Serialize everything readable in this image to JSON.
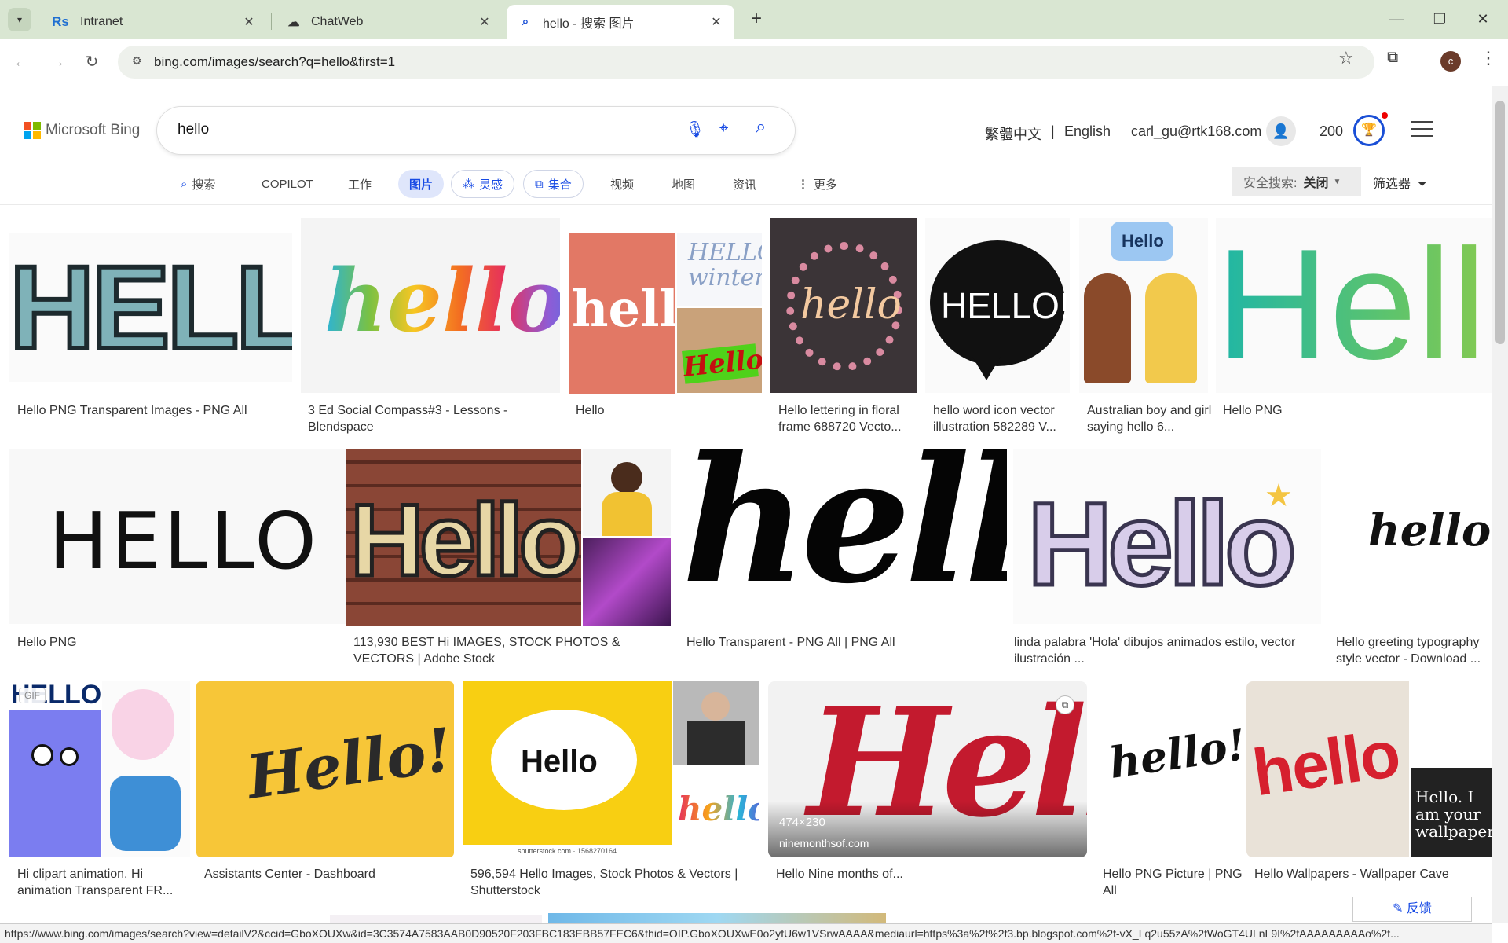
{
  "browser": {
    "tabs": [
      {
        "label": "Intranet",
        "favicon": "Rs"
      },
      {
        "label": "ChatWeb",
        "favicon": "cloud-icon"
      },
      {
        "label": "hello - 搜索 图片",
        "favicon": "search-icon"
      }
    ],
    "url": "bing.com/images/search?q=hello&first=1",
    "profile_initial": "c",
    "status_url": "https://www.bing.com/images/search?view=detailV2&ccid=GboXOUXw&id=3C3574A7583AAB0D90520F203FBC183EBB57FEC6&thid=OIP.GboXOUXwE0o2yfU6w1VSrwAAAA&mediaurl=https%3a%2f%2f3.bp.blogspot.com%2f-vX_Lq2u55zA%2fWoGT4ULnL9I%2fAAAAAAAAAo%2f..."
  },
  "bing": {
    "logo_text": "Microsoft Bing",
    "query": "hello",
    "lang_trad": "繁體中文",
    "lang_sep": "|",
    "lang_en": "English",
    "account": "carl_gu@rtk168.com",
    "points": "200",
    "scopes": [
      "搜索",
      "COPILOT",
      "工作",
      "图片",
      "灵感",
      "集合",
      "视频",
      "地图",
      "资讯",
      "更多"
    ],
    "safesearch_label": "安全搜索:",
    "safesearch_value": "关闭",
    "filter_label": "筛选器",
    "feedback": "反馈"
  },
  "results": [
    {
      "caption": "Hello PNG Transparent Images - PNG All",
      "art": "HELLO"
    },
    {
      "caption": "3 Ed Social Compass#3 - Lessons - Blendspace",
      "art": "hello."
    },
    {
      "caption": "Hello",
      "art": "hello"
    },
    {
      "caption": "Hello lettering in floral frame 688720 Vecto...",
      "art": "hello"
    },
    {
      "caption": "hello word icon vector illustration 582289 V...",
      "art": "HELLO!"
    },
    {
      "caption": "Australian boy and girl saying hello 6...",
      "art": "Hello"
    },
    {
      "caption": "Hello PNG",
      "art": "Hello"
    },
    {
      "caption": "Hello PNG",
      "art": "HELLO"
    },
    {
      "caption": "113,930 BEST Hi IMAGES, STOCK PHOTOS & VECTORS | Adobe Stock",
      "art": "Hello"
    },
    {
      "caption": "Hello Transparent - PNG All | PNG All",
      "art": "hello!"
    },
    {
      "caption": "linda palabra 'Hola' dibujos animados estilo, vector ilustración ...",
      "art": "Hello"
    },
    {
      "caption": "Hello greeting typography style vector - Download ...",
      "art": "hello"
    },
    {
      "caption": "Hi clipart animation, Hi animation Transparent FR...",
      "art": "HELLO!",
      "badge": "GIF"
    },
    {
      "caption": "Assistants Center - Dashboard",
      "art": "Hello!"
    },
    {
      "caption": "596,594 Hello Images, Stock Photos & Vectors | Shutterstock",
      "art": "Hello",
      "sub": "shutterstock.com · 1568270164"
    },
    {
      "caption": "Hello Nine months of...",
      "art": "Hello",
      "dims": "474×230",
      "source": "ninemonthsof.com"
    },
    {
      "caption": "Hello PNG Picture | PNG All",
      "art": "hello!"
    },
    {
      "caption": "Hello Wallpapers - Wallpaper Cave",
      "art": "hello",
      "sub": "Hello. I am your wallpaper."
    }
  ]
}
